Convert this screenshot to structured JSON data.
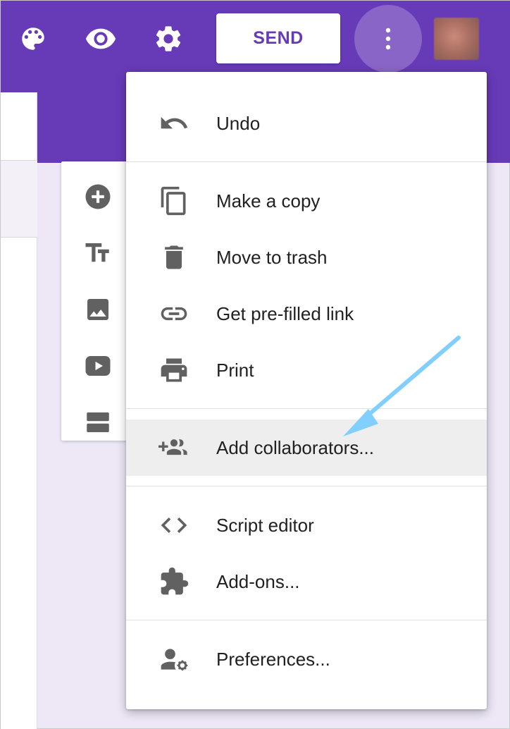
{
  "toolbar": {
    "send_label": "SEND",
    "icons": [
      "palette-icon",
      "eye-icon",
      "gear-icon",
      "more-vert-icon"
    ]
  },
  "side_toolbar": {
    "tools": [
      "add-circle-icon",
      "text-size-icon",
      "image-icon",
      "video-icon",
      "section-icon"
    ]
  },
  "menu": {
    "items": [
      {
        "label": "Undo",
        "icon": "undo-icon"
      },
      {
        "label": "Make a copy",
        "icon": "copy-icon"
      },
      {
        "label": "Move to trash",
        "icon": "trash-icon"
      },
      {
        "label": "Get pre-filled link",
        "icon": "link-icon"
      },
      {
        "label": "Print",
        "icon": "print-icon"
      },
      {
        "label": "Add collaborators...",
        "icon": "add-people-icon",
        "highlighted": true
      },
      {
        "label": "Script editor",
        "icon": "code-icon"
      },
      {
        "label": "Add-ons...",
        "icon": "puzzle-icon"
      },
      {
        "label": "Preferences...",
        "icon": "person-settings-icon"
      }
    ]
  },
  "colors": {
    "brand": "#673ab7",
    "background": "#ede7f6",
    "icon_gray": "#616161",
    "highlight": "#eeeeee",
    "annotation_arrow": "#81cfff"
  }
}
